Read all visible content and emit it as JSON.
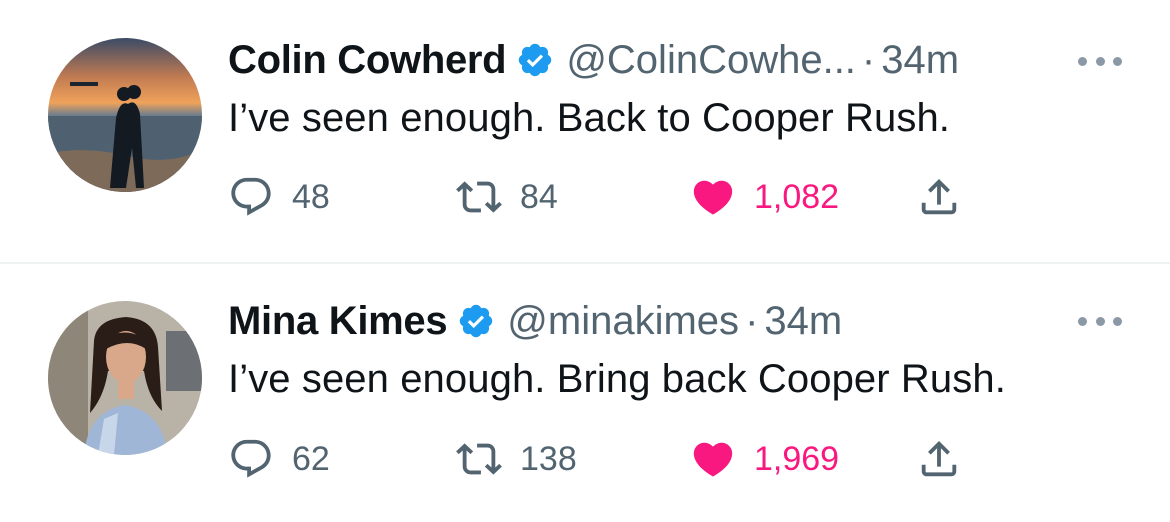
{
  "tweets": [
    {
      "name": "Colin Cowherd",
      "handle": "@ColinCowhe...",
      "dot": "·",
      "time": "34m",
      "text": "I’ve seen enough. Back to Cooper Rush.",
      "replies": "48",
      "retweets": "84",
      "likes": "1,082",
      "liked": true
    },
    {
      "name": "Mina Kimes",
      "handle": "@minakimes",
      "dot": "·",
      "time": "34m",
      "text": "I’ve seen enough. Bring back Cooper Rush.",
      "replies": "62",
      "retweets": "138",
      "likes": "1,969",
      "liked": true
    }
  ],
  "icons": {
    "verified": "verified-badge-icon",
    "more": "more-dots-icon",
    "reply": "reply-icon",
    "retweet": "retweet-icon",
    "like": "heart-icon",
    "share": "share-icon"
  },
  "colors": {
    "verified": "#1d9bf0",
    "like": "#f91880",
    "secondary_text": "#536471"
  }
}
